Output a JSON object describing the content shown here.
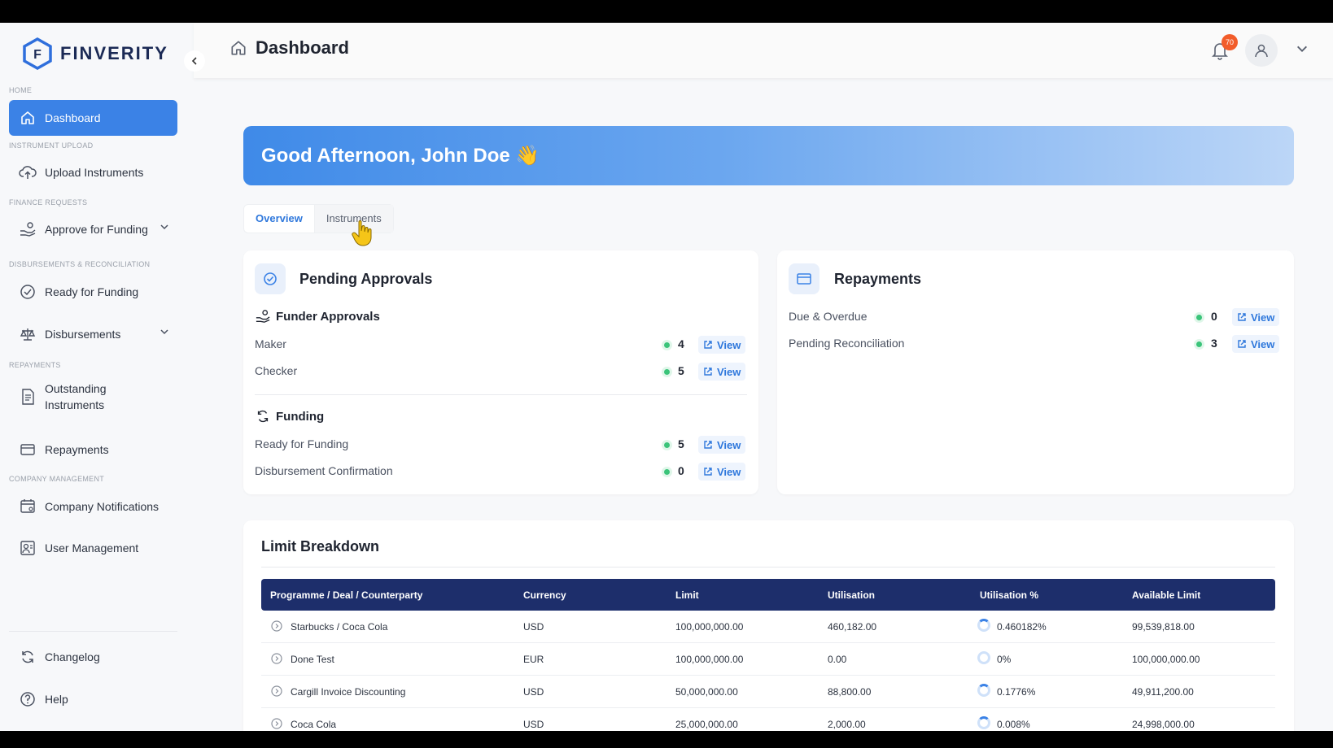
{
  "brand": {
    "name": "FINVERITY",
    "logo_letter": "F"
  },
  "header": {
    "title": "Dashboard",
    "notification_count": "70"
  },
  "sidebar": {
    "sections": {
      "home": "HOME",
      "instrument_upload": "INSTRUMENT UPLOAD",
      "finance_requests": "FINANCE REQUESTS",
      "disbursements": "DISBURSEMENTS & RECONCILIATION",
      "repayments": "REPAYMENTS",
      "company_management": "COMPANY MANAGEMENT"
    },
    "items": {
      "dashboard": "Dashboard",
      "upload_instruments": "Upload Instruments",
      "approve_for_funding": "Approve for Funding",
      "ready_for_funding": "Ready for Funding",
      "disbursements": "Disbursements",
      "outstanding_line1": "Outstanding",
      "outstanding_line2": "Instruments",
      "repayments": "Repayments",
      "company_notifications": "Company Notifications",
      "user_management": "User Management",
      "changelog": "Changelog",
      "help": "Help"
    }
  },
  "banner": {
    "greeting": "Good Afternoon, John Doe 👋"
  },
  "tabs": {
    "overview": "Overview",
    "instruments": "Instruments"
  },
  "pending": {
    "title": "Pending Approvals",
    "funder_title": "Funder Approvals",
    "funding_title": "Funding",
    "view": "View",
    "rows": [
      {
        "label": "Maker",
        "count": "4"
      },
      {
        "label": "Checker",
        "count": "5"
      },
      {
        "label": "Ready for Funding",
        "count": "5"
      },
      {
        "label": "Disbursement Confirmation",
        "count": "0"
      }
    ]
  },
  "repayments_card": {
    "title": "Repayments",
    "rows": [
      {
        "label": "Due & Overdue",
        "count": "0"
      },
      {
        "label": "Pending Reconciliation",
        "count": "3"
      }
    ]
  },
  "limit": {
    "title": "Limit Breakdown",
    "columns": [
      "Programme / Deal / Counterparty",
      "Currency",
      "Limit",
      "Utilisation",
      "Utilisation %",
      "Available Limit"
    ],
    "rows": [
      [
        "Starbucks / Coca Cola",
        "USD",
        "100,000,000.00",
        "460,182.00",
        "0.460182%",
        "99,539,818.00"
      ],
      [
        "Done Test",
        "EUR",
        "100,000,000.00",
        "0.00",
        "0%",
        "100,000,000.00"
      ],
      [
        "Cargill Invoice Discounting",
        "USD",
        "50,000,000.00",
        "88,800.00",
        "0.1776%",
        "49,911,200.00"
      ],
      [
        "Coca Cola",
        "USD",
        "25,000,000.00",
        "2,000.00",
        "0.008%",
        "24,998,000.00"
      ]
    ]
  },
  "colors": {
    "primary": "#3b82e6",
    "table_header": "#1d2e6b",
    "badge": "#f25c2a",
    "status_green": "#3bc47a"
  }
}
